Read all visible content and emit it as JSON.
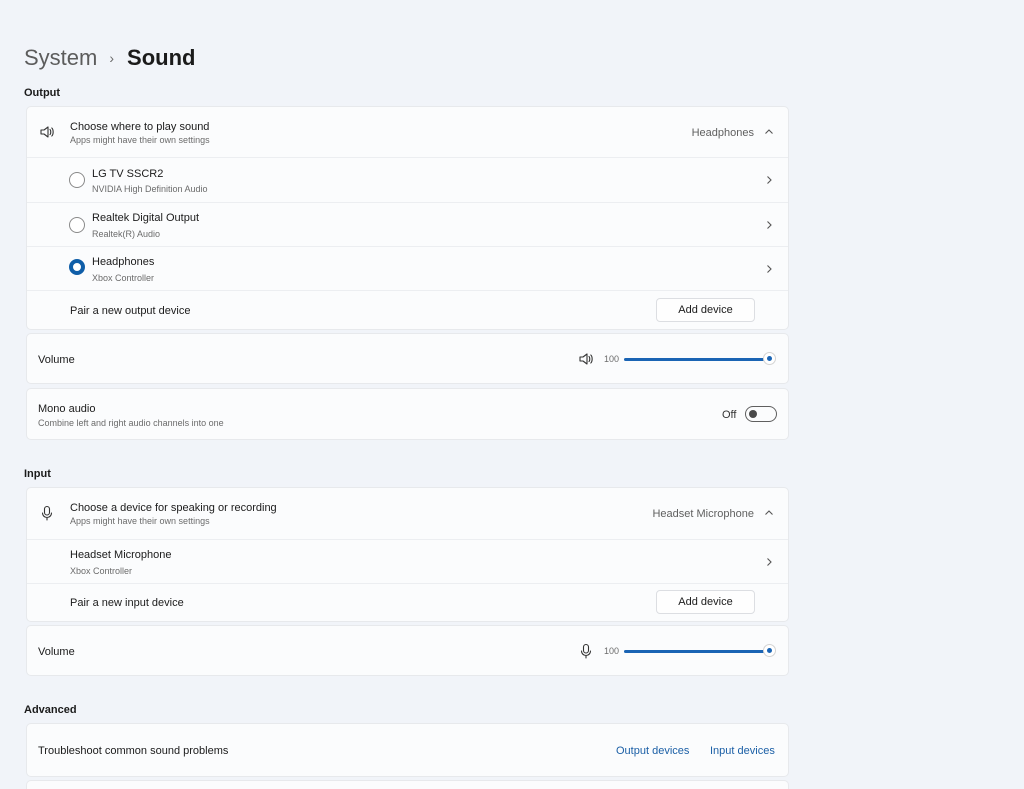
{
  "breadcrumb": {
    "parent": "System",
    "separator": "›",
    "current": "Sound"
  },
  "output": {
    "header": "Output",
    "choose": {
      "title": "Choose where to play sound",
      "subtitle": "Apps might have their own settings",
      "selected": "Headphones",
      "icon": "speaker-icon"
    },
    "devices": [
      {
        "name": "LG TV SSCR2",
        "driver": "NVIDIA High Definition Audio",
        "selected": false
      },
      {
        "name": "Realtek Digital Output",
        "driver": "Realtek(R) Audio",
        "selected": false
      },
      {
        "name": "Headphones",
        "driver": "Xbox Controller",
        "selected": true
      }
    ],
    "pair": {
      "label": "Pair a new output device",
      "button": "Add device"
    },
    "volume": {
      "label": "Volume",
      "value": "100",
      "level": 1.0
    },
    "mono": {
      "title": "Mono audio",
      "subtitle": "Combine left and right audio channels into one",
      "state": "Off"
    }
  },
  "input": {
    "header": "Input",
    "choose": {
      "title": "Choose a device for speaking or recording",
      "subtitle": "Apps might have their own settings",
      "selected": "Headset Microphone",
      "icon": "microphone-icon"
    },
    "devices": [
      {
        "name": "Headset Microphone",
        "driver": "Xbox Controller"
      }
    ],
    "pair": {
      "label": "Pair a new input device",
      "button": "Add device"
    },
    "volume": {
      "label": "Volume",
      "value": "100",
      "level": 1.0
    }
  },
  "advanced": {
    "header": "Advanced",
    "troubleshoot": {
      "label": "Troubleshoot common sound problems",
      "link_output": "Output devices",
      "link_input": "Input devices"
    }
  },
  "colors": {
    "accent": "#1a64b4",
    "background": "#f1f4f9",
    "card": "#fbfcfd"
  }
}
